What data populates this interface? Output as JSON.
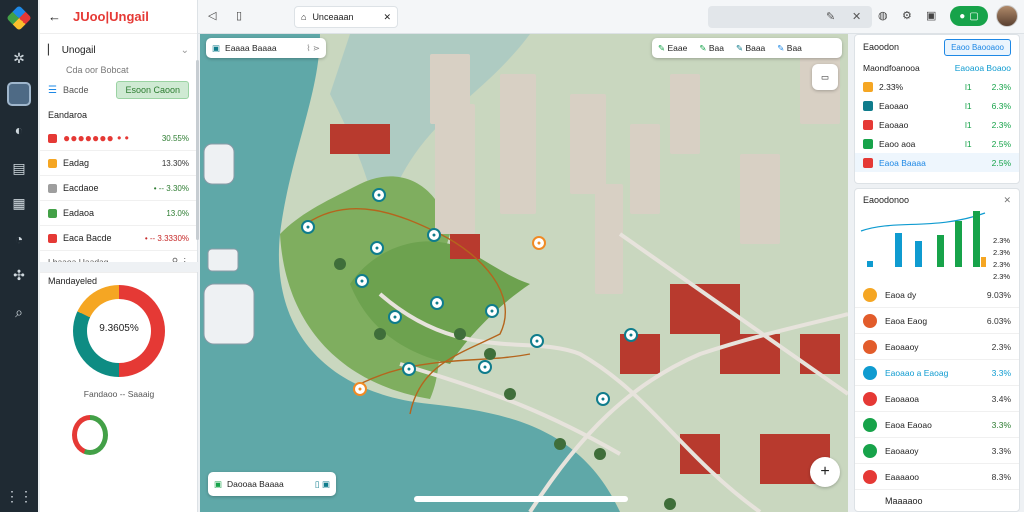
{
  "toolbar": {
    "tab_label": "Unceaaan",
    "back": "←"
  },
  "left": {
    "brand": "JUoo|Ungail",
    "section_title": "Unogail",
    "sub": "Cda oor Bobcat",
    "filter_label": "Bacde",
    "green_button": "Esoon Caoon",
    "list_header": "Eandaroa",
    "items": [
      {
        "label": "",
        "value": "30.55%",
        "color": "#e53935",
        "valcolor": "#2e7d32"
      },
      {
        "label": "Eadag",
        "value": "13.30%",
        "color": "#f5a623",
        "valcolor": "#333"
      },
      {
        "label": "Eacdaoe",
        "value": "• -- 3.30%",
        "color": "#9e9e9e",
        "valcolor": "#2e7d32"
      },
      {
        "label": "Eadaoa",
        "value": "13.0%",
        "color": "#43a047",
        "valcolor": "#2e7d32"
      },
      {
        "label": "Eaca Bacde",
        "value": "• -- 3.3330%",
        "color": "#e53935",
        "valcolor": "#c62828"
      }
    ],
    "list_footer": "Lbaaoa Uaadag",
    "chart_title": "Mandayeled",
    "donut_center": "9.3605%",
    "legend_label": "Fandaoo -- Saaaig"
  },
  "map": {
    "search_card": "Eaaaa Baaaa",
    "tags": [
      {
        "label": "Eaae",
        "color": "#17a34a"
      },
      {
        "label": "Baa",
        "color": "#17a34a"
      },
      {
        "label": "Baaa",
        "color": "#0f7c8c"
      },
      {
        "label": "Baa",
        "color": "#1e88e5"
      }
    ],
    "bottom_card": "Daooaa Baaaa"
  },
  "right": {
    "header_label": "Eaoodon",
    "header_button": "Eaoo Baooaoo",
    "table_title": "Maondfoanooa",
    "table_col": "Eaoaoa Boaoo",
    "rows": [
      {
        "label": "2.33%",
        "mid": "l1",
        "val": "2.3%",
        "color": "#f5a623"
      },
      {
        "label": "Eaoaao",
        "mid": "l1",
        "val": "6.3%",
        "color": "#0f7c8c"
      },
      {
        "label": "Eaoaao",
        "mid": "l1",
        "val": "2.3%",
        "color": "#e53935"
      },
      {
        "label": "Eaoo aoa",
        "mid": "l1",
        "val": "2.5%",
        "color": "#17a34a"
      },
      {
        "label": "Eaoa Baaaa",
        "mid": "",
        "val": "2.5%",
        "color": "#e53935"
      }
    ],
    "chart_title": "Eaoodonoo",
    "chart_ticks": [
      "2.3%",
      "2.3%",
      "2.3%",
      "2.3%"
    ],
    "list": [
      {
        "label": "Eaoa dy",
        "val": "9.03%",
        "color": "#f5a623",
        "valcolor": "#333"
      },
      {
        "label": "Eaoa Eaog",
        "val": "6.03%",
        "color": "#e25c2b",
        "valcolor": "#333"
      },
      {
        "label": "Eaoaaoy",
        "val": "2.3%",
        "color": "#e25c2b",
        "valcolor": "#333"
      },
      {
        "label": "Eaoaao a Eaoag",
        "val": "3.3%",
        "color": "#0f9bd0",
        "valcolor": "#0f9bd0"
      },
      {
        "label": "Eaoaaoa",
        "val": "3.4%",
        "color": "#e53935",
        "valcolor": "#333"
      },
      {
        "label": "Eaoa Eaoao",
        "val": "3.3%",
        "color": "#17a34a",
        "valcolor": "#2e7d32"
      },
      {
        "label": "Eaoaaoy",
        "val": "3.3%",
        "color": "#17a34a",
        "valcolor": "#333"
      },
      {
        "label": "Eaaaaoo",
        "val": "8.3%",
        "color": "#e53935",
        "valcolor": "#333"
      }
    ],
    "footer": "Maaaaoo"
  }
}
